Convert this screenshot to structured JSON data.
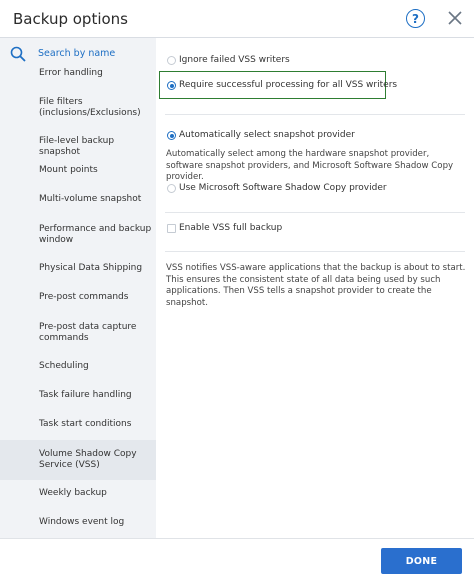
{
  "header": {
    "title": "Backup options"
  },
  "search": {
    "placeholder": "Search by name"
  },
  "sidebar": {
    "items": [
      {
        "label": "Error handling"
      },
      {
        "label": "File filters (inclusions/Exclusions)"
      },
      {
        "label": "File-level backup snapshot"
      },
      {
        "label": "Mount points"
      },
      {
        "label": "Multi-volume snapshot"
      },
      {
        "label": "Performance and backup window"
      },
      {
        "label": "Physical Data Shipping"
      },
      {
        "label": "Pre-post commands"
      },
      {
        "label": "Pre-post data capture commands"
      },
      {
        "label": "Scheduling"
      },
      {
        "label": "Task failure handling"
      },
      {
        "label": "Task start conditions"
      },
      {
        "label": "Volume Shadow Copy Service (VSS)"
      },
      {
        "label": "Weekly backup"
      },
      {
        "label": "Windows event log"
      }
    ],
    "active_index": 12
  },
  "main": {
    "ignore_failed_label": "Ignore failed VSS writers",
    "require_successful_label": "Require successful processing for all VSS writers",
    "auto_select_label": "Automatically select snapshot provider",
    "auto_select_desc": "Automatically select among the hardware snapshot provider, software snapshot providers, and Microsoft Software Shadow Copy provider.",
    "use_microsoft_label": "Use Microsoft Software Shadow Copy provider",
    "enable_full_backup_label": "Enable VSS full backup",
    "vss_note": "VSS notifies VSS-aware applications that the backup is about to start. This ensures the consistent state of all data being used by such applications. Then VSS tells a snapshot provider to create the snapshot."
  },
  "footer": {
    "done_label": "DONE"
  },
  "colors": {
    "accent": "#1e6fc4",
    "done_button": "#2a6fce",
    "highlight_border": "#2e7d32",
    "sidebar_bg": "#f1f3f6"
  }
}
